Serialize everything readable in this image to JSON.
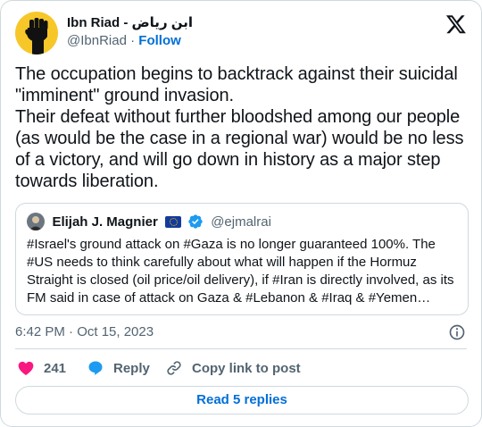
{
  "author": {
    "display_name": "Ibn Riad - ابن رياض",
    "handle": "@IbnRiad",
    "separator": "·",
    "follow_label": "Follow",
    "avatar_icon": "raised-fist-icon"
  },
  "brand_icon": "x-logo-icon",
  "tweet": {
    "text": "The occupation begins to backtrack against their suicidal \"imminent\" ground invasion.\nTheir defeat without further bloodshed among our people (as would be the case in a regional war) would be no less of a victory, and will go down in history as a major step towards liberation."
  },
  "quoted_tweet": {
    "author_name": "Elijah J. Magnier",
    "handle": "@ejmalrai",
    "badges": [
      "eu-flag-icon",
      "verified-badge-icon"
    ],
    "text": "#Israel's ground attack on #Gaza is no longer guaranteed 100%. The #US needs to think carefully about what will happen if the Hormuz Straight is closed (oil price/oil delivery), if #Iran is directly involved, as its FM said in case of attack on Gaza & #Lebanon & #Iraq & #Yemen…"
  },
  "timestamp": "6:42 PM · Oct 15, 2023",
  "actions": {
    "like_count": "241",
    "reply_label": "Reply",
    "copy_label": "Copy link to post"
  },
  "read_replies_label": "Read 5 replies",
  "colors": {
    "accent": "#006fd6",
    "like": "#f91880",
    "reply_icon": "#1d9bf0",
    "border": "#cfd9de",
    "secondary_text": "#536471"
  }
}
